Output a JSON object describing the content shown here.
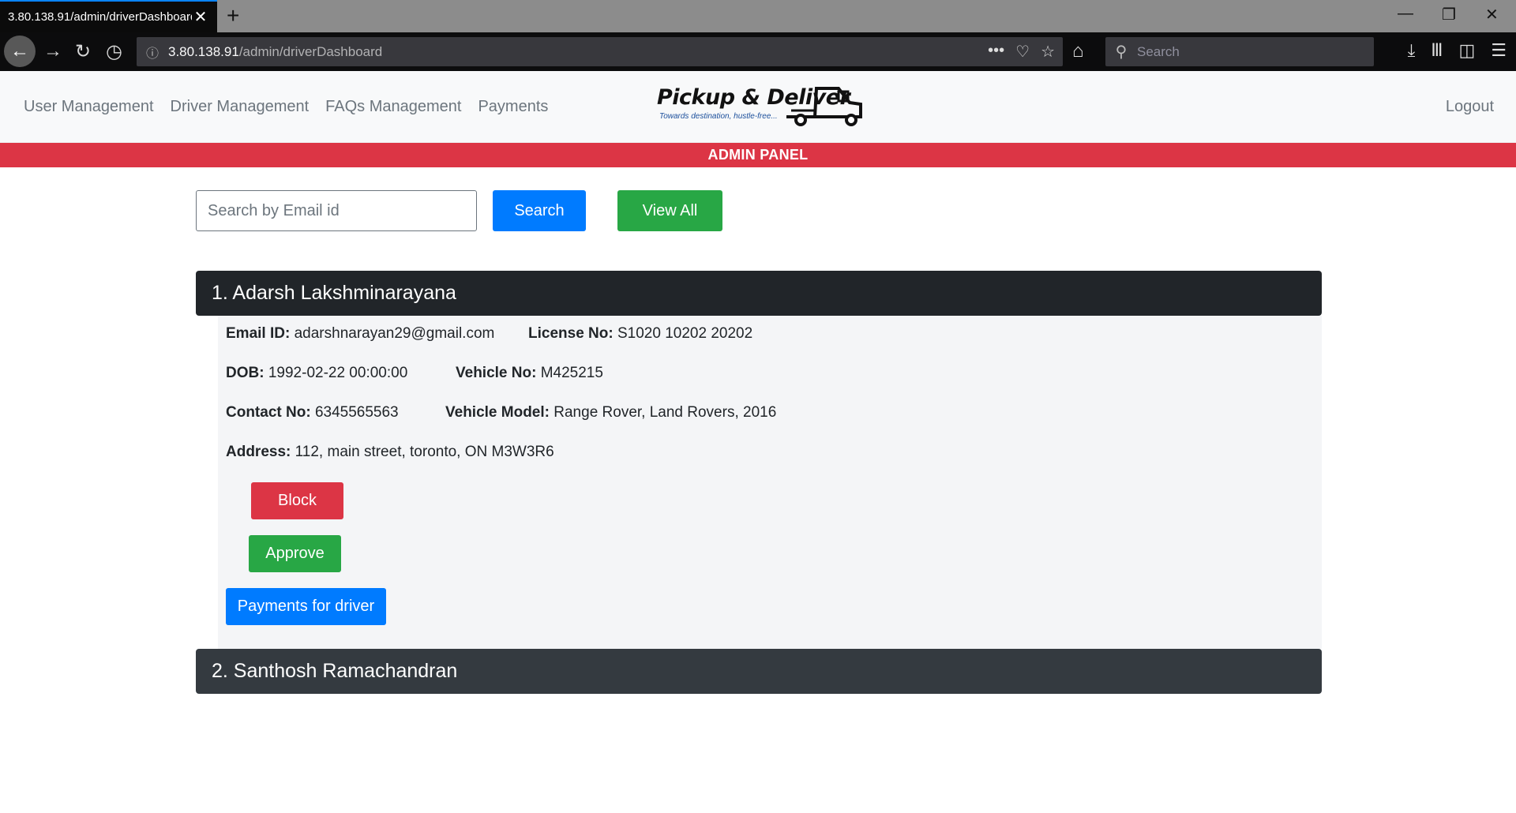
{
  "browser": {
    "tab_title": "3.80.138.91/admin/driverDashboard",
    "url_host": "3.80.138.91",
    "url_path": "/admin/driverDashboard",
    "search_placeholder": "Search"
  },
  "site": {
    "nav_links": [
      "User Management",
      "Driver Management",
      "FAQs Management",
      "Payments"
    ],
    "logo_title": "Pickup & Deliver",
    "logo_tagline": "Towards destination, hustle-free...",
    "logout": "Logout",
    "admin_banner": "ADMIN PANEL"
  },
  "search": {
    "placeholder": "Search by Email id",
    "search_label": "Search",
    "view_all_label": "View All"
  },
  "drivers": [
    {
      "header": "1. Adarsh Lakshminarayana",
      "email_label": "Email ID:",
      "email": "adarshnarayan29@gmail.com",
      "license_label": "License No:",
      "license": "S1020 10202 20202",
      "dob_label": "DOB:",
      "dob": "1992-02-22 00:00:00",
      "vehicle_no_label": "Vehicle No:",
      "vehicle_no": "M425215",
      "contact_label": "Contact No:",
      "contact": "6345565563",
      "vehicle_model_label": "Vehicle Model:",
      "vehicle_model": "Range Rover, Land Rovers, 2016",
      "address_label": "Address:",
      "address": "112, main street, toronto, ON M3W3R6",
      "block_label": "Block",
      "approve_label": "Approve",
      "payments_label": "Payments for driver"
    },
    {
      "header": "2. Santhosh Ramachandran"
    }
  ],
  "colors": {
    "primary": "#007bff",
    "success": "#28a745",
    "danger": "#dc3545",
    "dark": "#212529"
  }
}
